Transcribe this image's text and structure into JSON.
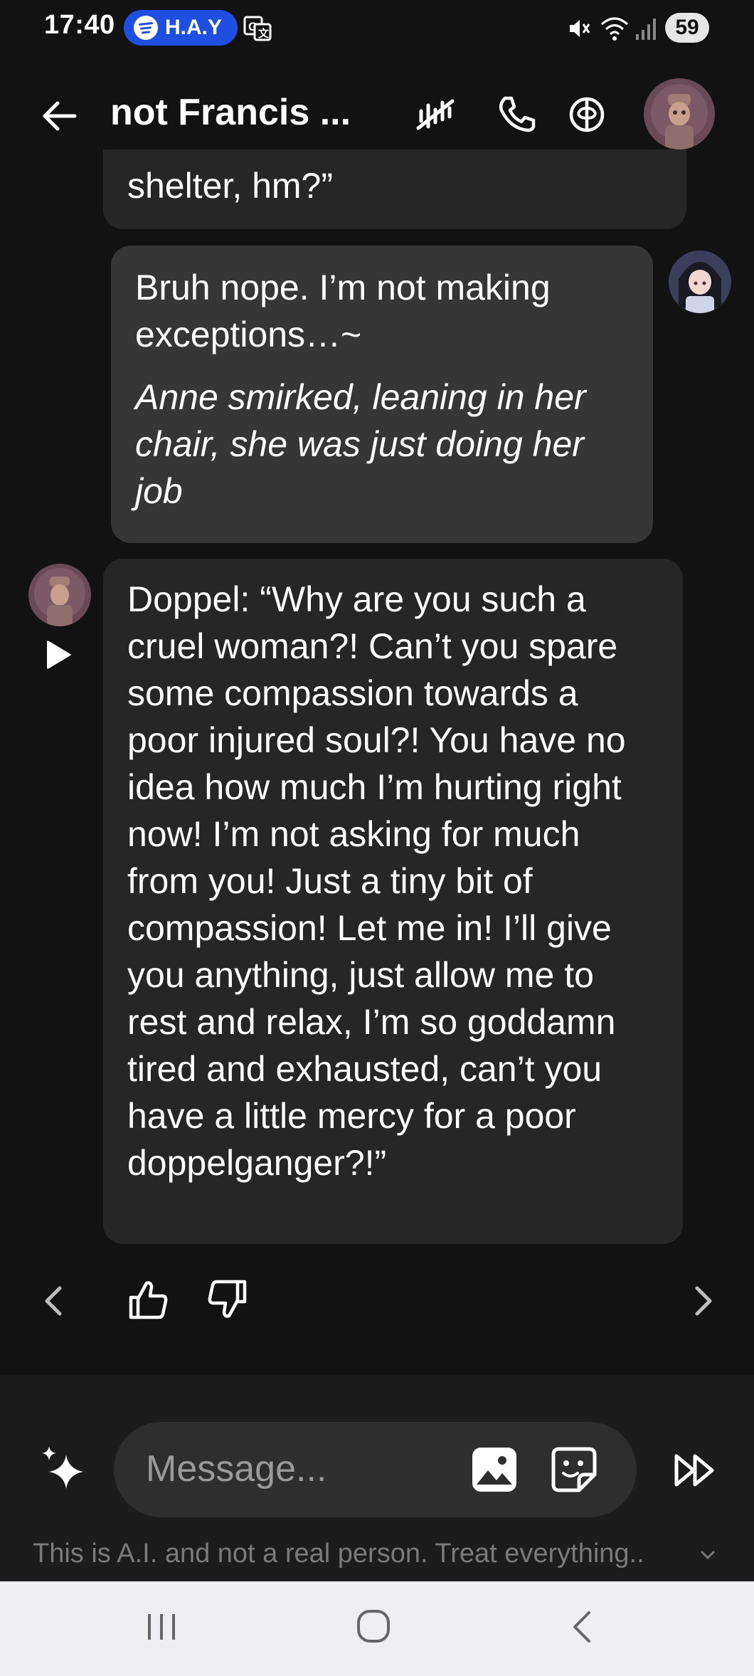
{
  "status_bar": {
    "time": "17:40",
    "spotify_label": "H.A.Y",
    "battery": "59"
  },
  "header": {
    "title": "not Francis ...",
    "icons": [
      "back-arrow-icon",
      "muted-voice-icon",
      "phone-icon",
      "brain-icon",
      "character-avatar"
    ]
  },
  "messages": [
    {
      "sender": "character",
      "text": "shelter, hm?”",
      "truncated_top": true
    },
    {
      "sender": "user",
      "text": "Bruh nope. I’m not making exceptions…~",
      "action": "Anne smirked, leaning in her chair, she was just doing her job"
    },
    {
      "sender": "character",
      "text": "Doppel: “Why are you such a cruel woman?! Can’t you spare some compassion towards a poor injured soul?! You have no idea how much I’m hurting right now! I’m not asking for much from you! Just a tiny bit of compassion! Let me in! I’ll give you anything, just allow me to rest and relax, I’m so goddamn tired and exhausted, can’t you have a little mercy for a poor doppelganger?!”"
    }
  ],
  "composer": {
    "placeholder": "Message...",
    "disclaimer": "This is A.I. and not a real person. Treat everything.."
  },
  "colors": {
    "background": "#121212",
    "user_bubble": "#363636",
    "bot_bubble": "#262626",
    "spotify_pill": "#1f4fe0",
    "nav_bar": "#efeff1"
  }
}
